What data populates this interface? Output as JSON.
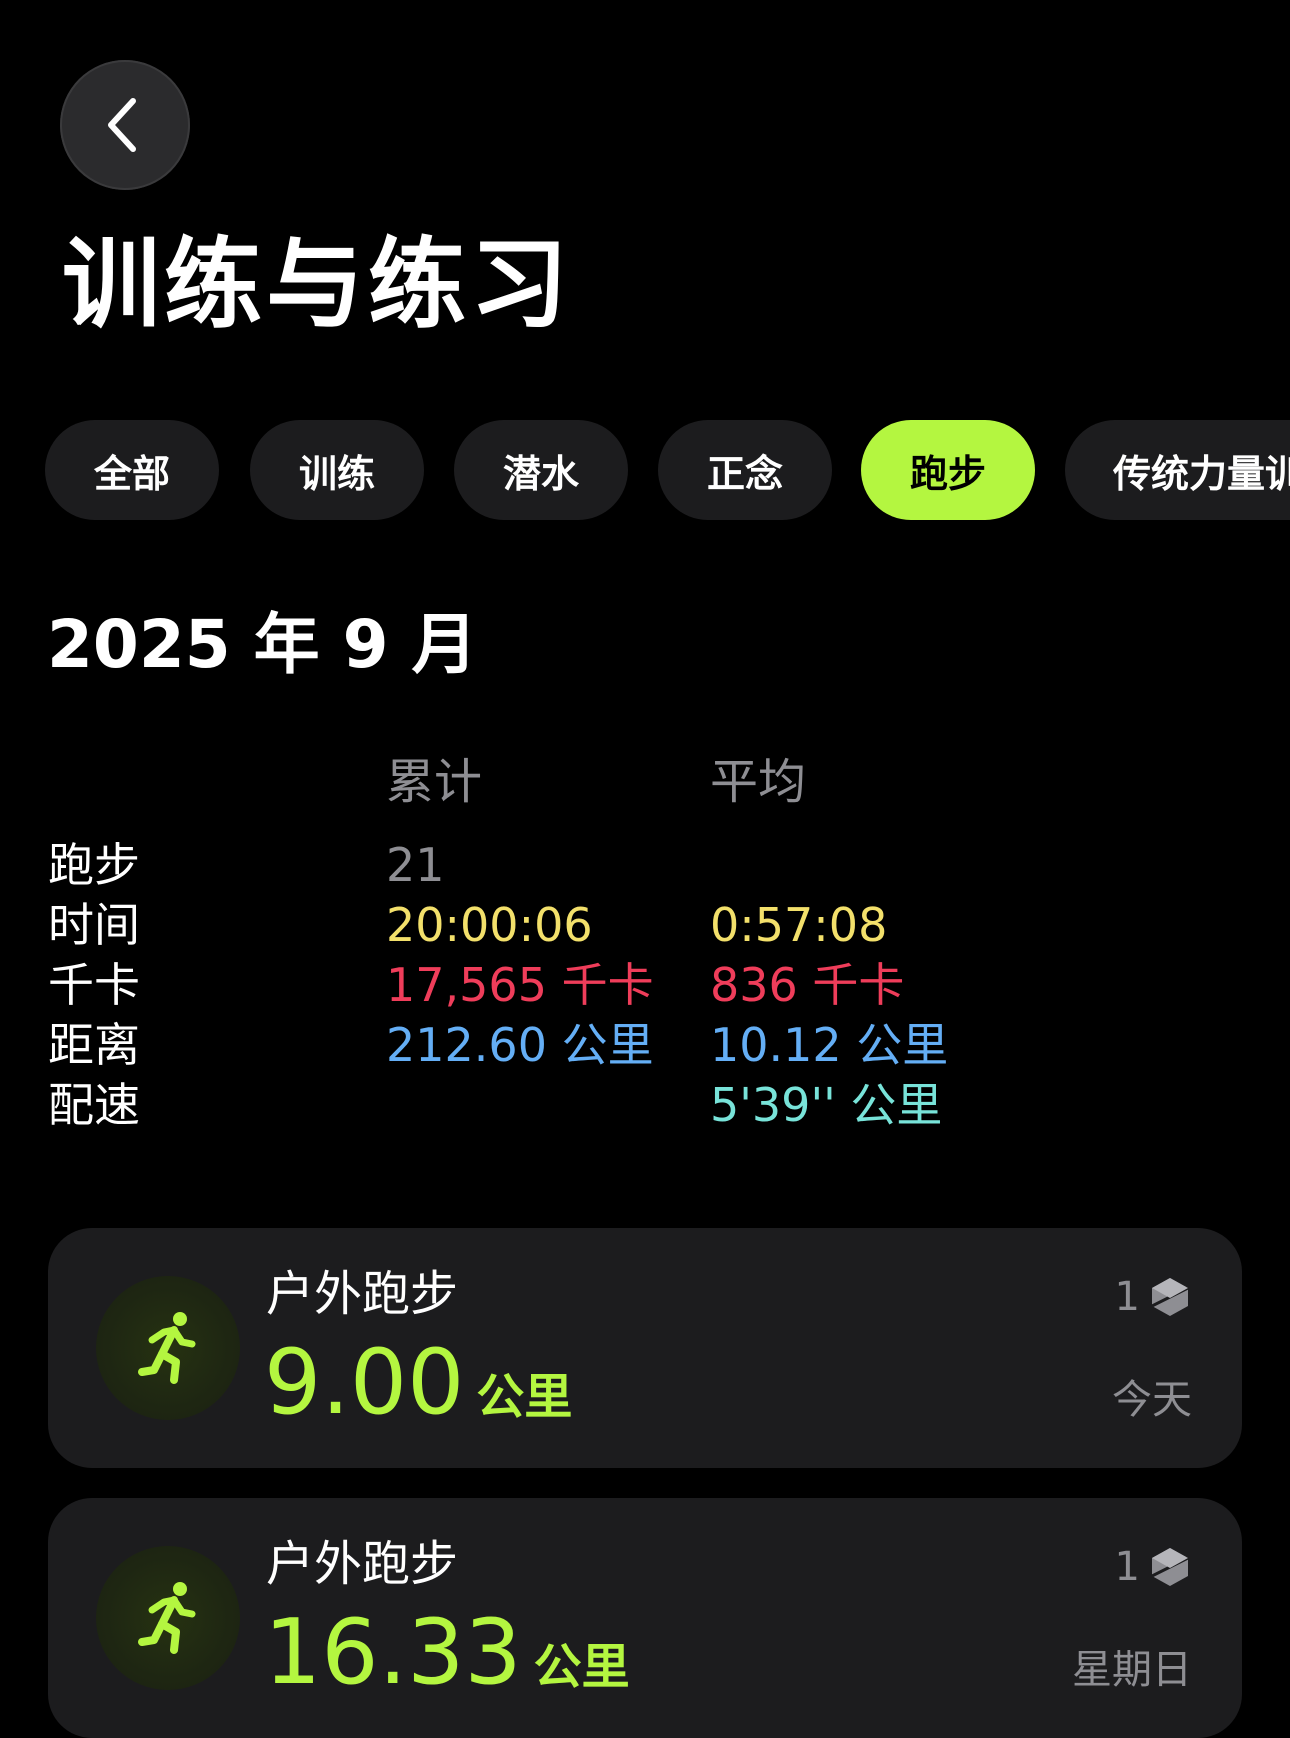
{
  "header": {
    "title": "训练与练习"
  },
  "filters": [
    {
      "label": "全部",
      "active": false
    },
    {
      "label": "训练",
      "active": false
    },
    {
      "label": "潜水",
      "active": false
    },
    {
      "label": "正念",
      "active": false
    },
    {
      "label": "跑步",
      "active": true
    },
    {
      "label": "传统力量训",
      "active": false
    }
  ],
  "summary": {
    "month": "2025 年 9 月",
    "col_total": "累计",
    "col_average": "平均",
    "rows": [
      {
        "label": "跑步",
        "total": "21",
        "average": ""
      },
      {
        "label": "时间",
        "total": "20:00:06",
        "average": "0:57:08"
      },
      {
        "label": "千卡",
        "total": "17,565 千卡",
        "average": "836 千卡"
      },
      {
        "label": "距离",
        "total": "212.60 公里",
        "average": "10.12 公里"
      },
      {
        "label": "配速",
        "total": "",
        "average": "5'39'' 公里"
      }
    ]
  },
  "colors": {
    "accent": "#b4f640",
    "time": "#f3e06b",
    "calories": "#ef3d5a",
    "distance": "#64aef5",
    "pace": "#78e3d9"
  },
  "workouts": [
    {
      "type": "户外跑步",
      "value": "9.00",
      "unit": "公里",
      "count": "1",
      "day": "今天",
      "icon": "running-figure-icon"
    },
    {
      "type": "户外跑步",
      "value": "16.33",
      "unit": "公里",
      "count": "1",
      "day": "星期日",
      "icon": "running-figure-icon"
    }
  ]
}
